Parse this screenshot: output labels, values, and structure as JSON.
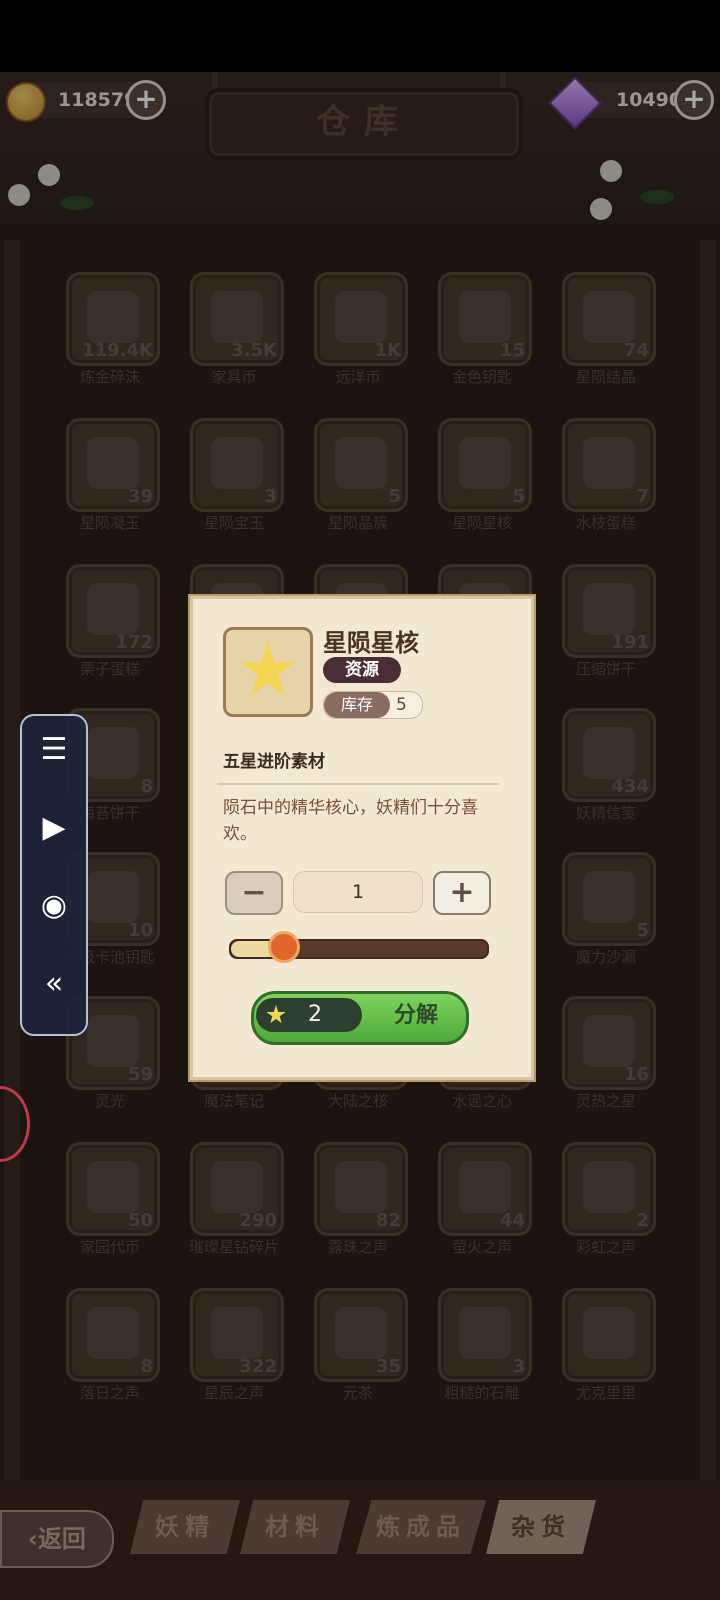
{
  "header": {
    "title": "仓库",
    "coins": "118579",
    "gems": "10490"
  },
  "grid": [
    {
      "name": "炼金碎沫",
      "count": "119.4K"
    },
    {
      "name": "家具币",
      "count": "3.5K"
    },
    {
      "name": "远洋币",
      "count": "1K"
    },
    {
      "name": "金色钥匙",
      "count": "15"
    },
    {
      "name": "星陨结晶",
      "count": "74"
    },
    {
      "name": "星陨凝玉",
      "count": "39"
    },
    {
      "name": "星陨宝玉",
      "count": "3"
    },
    {
      "name": "星陨晶簇",
      "count": "5"
    },
    {
      "name": "星陨星核",
      "count": "5"
    },
    {
      "name": "水枝蛋糕",
      "count": "7"
    },
    {
      "name": "栗子蛋糕",
      "count": "172"
    },
    {
      "name": "",
      "count": ""
    },
    {
      "name": "",
      "count": ""
    },
    {
      "name": "",
      "count": ""
    },
    {
      "name": "压缩饼干",
      "count": "191"
    },
    {
      "name": "海苔饼干",
      "count": "8"
    },
    {
      "name": "",
      "count": ""
    },
    {
      "name": "",
      "count": ""
    },
    {
      "name": "",
      "count": ""
    },
    {
      "name": "妖精信笺",
      "count": "434"
    },
    {
      "name": "高级卡池钥匙",
      "count": "10"
    },
    {
      "name": "",
      "count": ""
    },
    {
      "name": "",
      "count": ""
    },
    {
      "name": "",
      "count": ""
    },
    {
      "name": "魔力沙漏",
      "count": "5"
    },
    {
      "name": "灵光",
      "count": "59"
    },
    {
      "name": "魔法笔记",
      "count": ""
    },
    {
      "name": "大陆之核",
      "count": ""
    },
    {
      "name": "水谣之心",
      "count": ""
    },
    {
      "name": "灵热之星",
      "count": "16"
    },
    {
      "name": "家园代币",
      "count": "50"
    },
    {
      "name": "璀璨星钻碎片",
      "count": "290"
    },
    {
      "name": "露珠之声",
      "count": "82"
    },
    {
      "name": "萤火之声",
      "count": "44"
    },
    {
      "name": "彩虹之声",
      "count": "2"
    },
    {
      "name": "落日之声",
      "count": "8"
    },
    {
      "name": "星辰之声",
      "count": "322"
    },
    {
      "name": "元茶",
      "count": "35"
    },
    {
      "name": "粗糙的石雕",
      "count": "3"
    },
    {
      "name": "尤克里里",
      "count": ""
    }
  ],
  "dialog": {
    "name": "星陨星核",
    "type": "资源",
    "stock_label": "库存",
    "stock_value": "5",
    "subtitle": "五星进阶素材",
    "description": "陨石中的精华核心，妖精们十分喜欢。",
    "quantity": "1",
    "slider_fraction": 0.2,
    "cost": "2",
    "decompose_label": "分解",
    "minus": "−",
    "plus": "+"
  },
  "side_menu": {
    "icons": [
      "list-icon",
      "play-icon",
      "record-icon",
      "collapse-icon"
    ],
    "glyphs": [
      "☰",
      "▶",
      "◉",
      "«"
    ]
  },
  "tabs": [
    "妖精",
    "材料",
    "炼成品",
    "杂货"
  ],
  "back_label": "‹返回"
}
